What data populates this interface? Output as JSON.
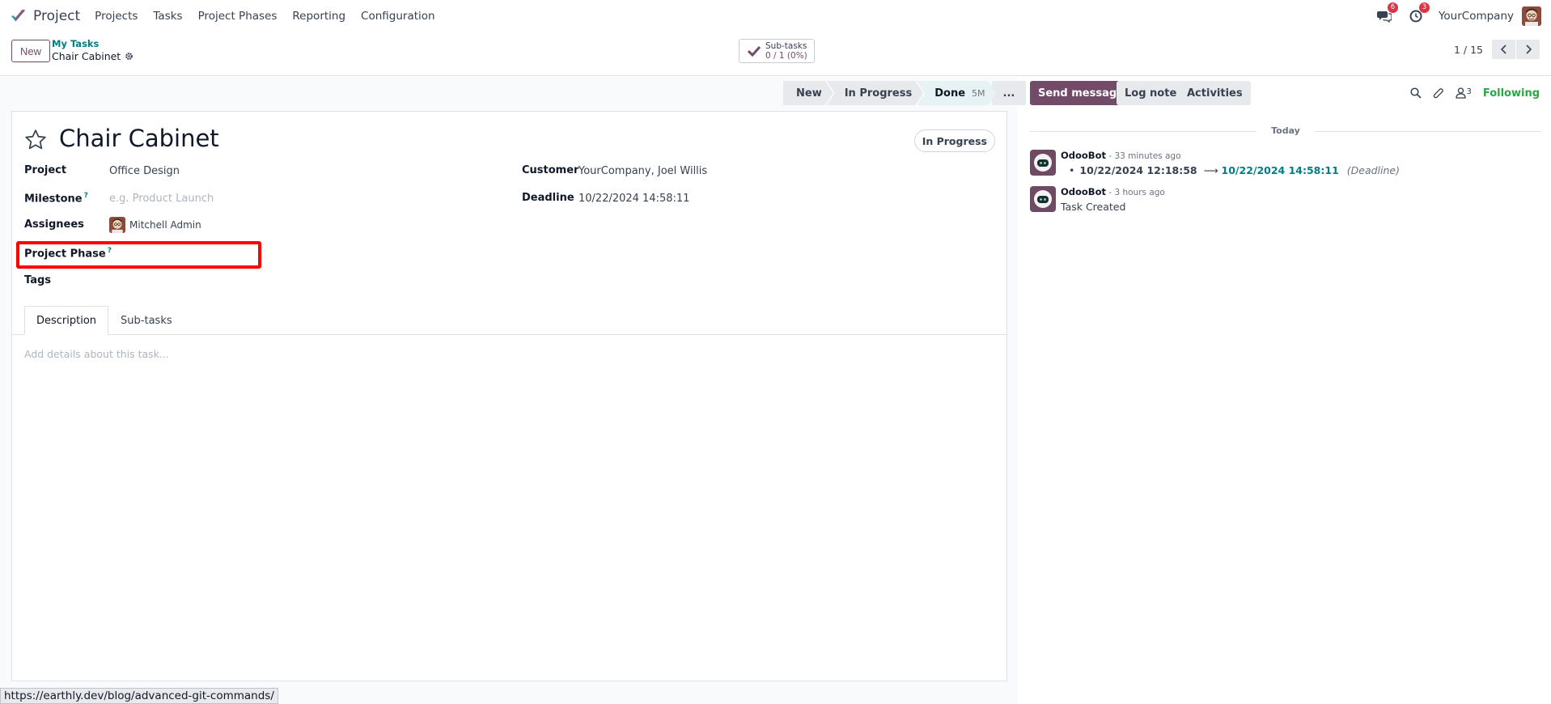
{
  "navbar": {
    "app_name": "Project",
    "menu": [
      "Projects",
      "Tasks",
      "Project Phases",
      "Reporting",
      "Configuration"
    ],
    "messages_badge": "6",
    "activities_badge": "3",
    "company": "YourCompany"
  },
  "control_panel": {
    "new_label": "New",
    "breadcrumb_parent": "My Tasks",
    "breadcrumb_current": "Chair Cabinet",
    "subtasks_label": "Sub-tasks",
    "subtasks_value": "0 / 1 (0%)",
    "pager": "1 / 15"
  },
  "statusbar": {
    "stages": [
      "New",
      "In Progress",
      "Done"
    ],
    "active_duration": "5M",
    "more": "..."
  },
  "form": {
    "title": "Chair Cabinet",
    "state": "In Progress",
    "project_label": "Project",
    "project_value": "Office Design",
    "milestone_label": "Milestone",
    "milestone_placeholder": "e.g. Product Launch",
    "assignees_label": "Assignees",
    "assignee_name": "Mitchell Admin",
    "phase_label": "Project Phase",
    "tags_label": "Tags",
    "customer_label": "Customer",
    "customer_value": "YourCompany, Joel Willis",
    "deadline_label": "Deadline",
    "deadline_value": "10/22/2024 14:58:11",
    "help_mark": "?",
    "tabs": [
      "Description",
      "Sub-tasks"
    ],
    "description_placeholder": "Add details about this task..."
  },
  "chatter": {
    "send_message": "Send message",
    "log_note": "Log note",
    "activities": "Activities",
    "follower_count": "3",
    "following": "Following",
    "date_separator": "Today",
    "messages": [
      {
        "author": "OdooBot",
        "time": " - 33 minutes ago",
        "old_value": "10/22/2024 12:18:58",
        "new_value": "10/22/2024 14:58:11",
        "field": "(Deadline)"
      },
      {
        "author": "OdooBot",
        "time": " - 3 hours ago",
        "body": "Task Created"
      }
    ]
  },
  "status_url": "https://earthly.dev/blog/advanced-git-commands/",
  "colors": {
    "brand": "#714b67",
    "link": "#017e84",
    "following": "#28a745",
    "highlight": "#ff0000"
  }
}
